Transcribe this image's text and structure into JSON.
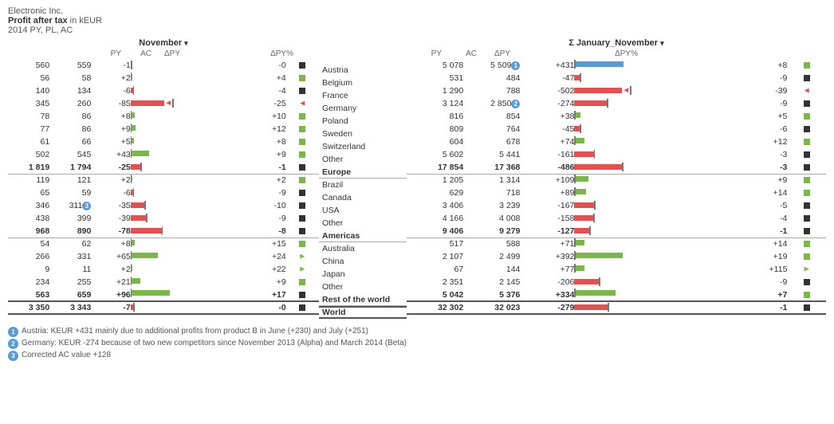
{
  "header": {
    "company": "Electronic Inc.",
    "metric": "Profit after tax",
    "unit": "in kEUR",
    "year_line": "2014 PY, PL, AC"
  },
  "left_panel": {
    "title": "November",
    "col_headers": [
      "PY",
      "AC",
      "ΔPY",
      "",
      "ΔPY%",
      ""
    ],
    "rows": [
      {
        "region": "Austria",
        "py": "560",
        "ac": "559",
        "dpy": "-1",
        "dpy_bar": {
          "type": "neg",
          "val": -1
        },
        "dpyp": "-0",
        "dpyp_bar": {
          "type": "sq",
          "color": "dark"
        }
      },
      {
        "region": "Belgium",
        "py": "56",
        "ac": "58",
        "dpy": "+2",
        "dpy_bar": {
          "type": "pos",
          "val": 2
        },
        "dpyp": "+4",
        "dpyp_bar": {
          "type": "sq",
          "color": "green"
        }
      },
      {
        "region": "France",
        "py": "140",
        "ac": "134",
        "dpy": "-6",
        "dpy_bar": {
          "type": "neg",
          "val": -6
        },
        "dpyp": "-4",
        "dpyp_bar": {
          "type": "sq",
          "color": "dark"
        }
      },
      {
        "region": "Germany",
        "py": "345",
        "ac": "260",
        "dpy": "-85",
        "dpy_bar": {
          "type": "neg_arrow",
          "val": -85
        },
        "dpyp": "-25",
        "dpyp_bar": {
          "type": "arr_l",
          "color": "red"
        }
      },
      {
        "region": "Poland",
        "py": "78",
        "ac": "86",
        "dpy": "+8",
        "dpy_bar": {
          "type": "pos",
          "val": 8
        },
        "dpyp": "+10",
        "dpyp_bar": {
          "type": "sq",
          "color": "green"
        }
      },
      {
        "region": "Sweden",
        "py": "77",
        "ac": "86",
        "dpy": "+9",
        "dpy_bar": {
          "type": "pos",
          "val": 9
        },
        "dpyp": "+12",
        "dpyp_bar": {
          "type": "sq",
          "color": "green"
        }
      },
      {
        "region": "Switzerland",
        "py": "61",
        "ac": "66",
        "dpy": "+5",
        "dpy_bar": {
          "type": "pos",
          "val": 5
        },
        "dpyp": "+8",
        "dpyp_bar": {
          "type": "sq",
          "color": "green"
        }
      },
      {
        "region": "Other",
        "py": "502",
        "ac": "545",
        "dpy": "+43",
        "dpy_bar": {
          "type": "pos",
          "val": 43
        },
        "dpyp": "+9",
        "dpyp_bar": {
          "type": "sq",
          "color": "green"
        }
      },
      {
        "region": "Europe",
        "py": "1 819",
        "ac": "1 794",
        "dpy": "-25",
        "dpy_bar": {
          "type": "neg",
          "val": -25
        },
        "dpyp": "-1",
        "dpyp_bar": {
          "type": "sq",
          "color": "dark"
        },
        "total": true
      },
      {
        "region": "Brazil",
        "py": "119",
        "ac": "121",
        "dpy": "+2",
        "dpy_bar": {
          "type": "pos",
          "val": 2
        },
        "dpyp": "+2",
        "dpyp_bar": {
          "type": "sq",
          "color": "green"
        }
      },
      {
        "region": "Canada",
        "py": "65",
        "ac": "59",
        "dpy": "-6",
        "dpy_bar": {
          "type": "neg",
          "val": -6
        },
        "dpyp": "-9",
        "dpyp_bar": {
          "type": "sq",
          "color": "dark"
        }
      },
      {
        "region": "USA",
        "py": "346",
        "ac": "311",
        "dpy": "-35",
        "dpy_bar": {
          "type": "neg",
          "val": -35
        },
        "dpyp": "-10",
        "dpyp_bar": {
          "type": "sq",
          "color": "dark"
        },
        "badge": "3"
      },
      {
        "region": "Other",
        "py": "438",
        "ac": "399",
        "dpy": "-39",
        "dpy_bar": {
          "type": "neg",
          "val": -39
        },
        "dpyp": "-9",
        "dpyp_bar": {
          "type": "sq",
          "color": "dark"
        }
      },
      {
        "region": "Americas",
        "py": "968",
        "ac": "890",
        "dpy": "-78",
        "dpy_bar": {
          "type": "neg",
          "val": -78
        },
        "dpyp": "-8",
        "dpyp_bar": {
          "type": "sq",
          "color": "dark"
        },
        "total": true
      },
      {
        "region": "Australia",
        "py": "54",
        "ac": "62",
        "dpy": "+8",
        "dpy_bar": {
          "type": "pos",
          "val": 8
        },
        "dpyp": "+15",
        "dpyp_bar": {
          "type": "sq",
          "color": "green"
        }
      },
      {
        "region": "China",
        "py": "266",
        "ac": "331",
        "dpy": "+65",
        "dpy_bar": {
          "type": "pos",
          "val": 65
        },
        "dpyp": "+24",
        "dpyp_bar": {
          "type": "arr_r",
          "color": "green"
        }
      },
      {
        "region": "Japan",
        "py": "9",
        "ac": "11",
        "dpy": "+2",
        "dpy_bar": {
          "type": "pos",
          "val": 2
        },
        "dpyp": "+22",
        "dpyp_bar": {
          "type": "arr_r",
          "color": "green"
        }
      },
      {
        "region": "Other",
        "py": "234",
        "ac": "255",
        "dpy": "+21",
        "dpy_bar": {
          "type": "pos",
          "val": 21
        },
        "dpyp": "+9",
        "dpyp_bar": {
          "type": "sq",
          "color": "green"
        }
      },
      {
        "region": "Rest of the world",
        "py": "563",
        "ac": "659",
        "dpy": "+96",
        "dpy_bar": {
          "type": "pos",
          "val": 96
        },
        "dpyp": "+17",
        "dpyp_bar": {
          "type": "sq",
          "color": "dark"
        },
        "total": true
      },
      {
        "region": "World",
        "py": "3 350",
        "ac": "3 343",
        "dpy": "-7",
        "dpy_bar": {
          "type": "neg",
          "val": -7
        },
        "dpyp": "-0",
        "dpyp_bar": {
          "type": "sq",
          "color": "dark"
        },
        "grand": true
      }
    ]
  },
  "right_panel": {
    "title": "Σ January_November",
    "col_headers": [
      "PY",
      "AC",
      "ΔPY",
      "",
      "ΔPY%",
      ""
    ],
    "rows": [
      {
        "py": "5 078",
        "ac": "5 509",
        "dpy": "+431",
        "dpy_bar": {
          "type": "pos_blue",
          "val": 431
        },
        "dpyp": "+8",
        "dpyp_bar": {
          "type": "sq",
          "color": "green"
        },
        "badge": "1"
      },
      {
        "py": "531",
        "ac": "484",
        "dpy": "-47",
        "dpy_bar": {
          "type": "neg",
          "val": -47
        },
        "dpyp": "-9",
        "dpyp_bar": {
          "type": "sq",
          "color": "dark"
        }
      },
      {
        "py": "1 290",
        "ac": "788",
        "dpy": "-502",
        "dpy_bar": {
          "type": "neg_arrow",
          "val": -502
        },
        "dpyp": "-39",
        "dpyp_bar": {
          "type": "arr_l",
          "color": "red"
        }
      },
      {
        "py": "3 124",
        "ac": "2 850",
        "dpy": "-274",
        "dpy_bar": {
          "type": "neg",
          "val": -274
        },
        "dpyp": "-9",
        "dpyp_bar": {
          "type": "sq",
          "color": "dark"
        },
        "badge": "2"
      },
      {
        "py": "816",
        "ac": "854",
        "dpy": "+38",
        "dpy_bar": {
          "type": "pos",
          "val": 38
        },
        "dpyp": "+5",
        "dpyp_bar": {
          "type": "sq",
          "color": "green"
        }
      },
      {
        "py": "809",
        "ac": "764",
        "dpy": "-45",
        "dpy_bar": {
          "type": "neg",
          "val": -45
        },
        "dpyp": "-6",
        "dpyp_bar": {
          "type": "sq",
          "color": "dark"
        }
      },
      {
        "py": "604",
        "ac": "678",
        "dpy": "+74",
        "dpy_bar": {
          "type": "pos",
          "val": 74
        },
        "dpyp": "+12",
        "dpyp_bar": {
          "type": "sq",
          "color": "green"
        }
      },
      {
        "py": "5 602",
        "ac": "5 441",
        "dpy": "-161",
        "dpy_bar": {
          "type": "neg",
          "val": -161
        },
        "dpyp": "-3",
        "dpyp_bar": {
          "type": "sq",
          "color": "dark"
        }
      },
      {
        "py": "17 854",
        "ac": "17 368",
        "dpy": "-486",
        "dpy_bar": {
          "type": "neg",
          "val": -486
        },
        "dpyp": "-3",
        "dpyp_bar": {
          "type": "sq",
          "color": "dark"
        },
        "total": true
      },
      {
        "py": "1 205",
        "ac": "1 314",
        "dpy": "+109",
        "dpy_bar": {
          "type": "pos",
          "val": 109
        },
        "dpyp": "+9",
        "dpyp_bar": {
          "type": "sq",
          "color": "green"
        }
      },
      {
        "py": "629",
        "ac": "718",
        "dpy": "+89",
        "dpy_bar": {
          "type": "pos",
          "val": 89
        },
        "dpyp": "+14",
        "dpyp_bar": {
          "type": "sq",
          "color": "green"
        }
      },
      {
        "py": "3 406",
        "ac": "3 239",
        "dpy": "-167",
        "dpy_bar": {
          "type": "neg",
          "val": -167
        },
        "dpyp": "-5",
        "dpyp_bar": {
          "type": "sq",
          "color": "dark"
        }
      },
      {
        "py": "4 166",
        "ac": "4 008",
        "dpy": "-158",
        "dpy_bar": {
          "type": "neg",
          "val": -158
        },
        "dpyp": "-4",
        "dpyp_bar": {
          "type": "sq",
          "color": "dark"
        }
      },
      {
        "py": "9 406",
        "ac": "9 279",
        "dpy": "-127",
        "dpy_bar": {
          "type": "neg",
          "val": -127
        },
        "dpyp": "-1",
        "dpyp_bar": {
          "type": "sq",
          "color": "dark"
        },
        "total": true
      },
      {
        "py": "517",
        "ac": "588",
        "dpy": "+71",
        "dpy_bar": {
          "type": "pos",
          "val": 71
        },
        "dpyp": "+14",
        "dpyp_bar": {
          "type": "sq",
          "color": "green"
        }
      },
      {
        "py": "2 107",
        "ac": "2 499",
        "dpy": "+392",
        "dpy_bar": {
          "type": "pos",
          "val": 392
        },
        "dpyp": "+19",
        "dpyp_bar": {
          "type": "sq",
          "color": "green"
        }
      },
      {
        "py": "67",
        "ac": "144",
        "dpy": "+77",
        "dpy_bar": {
          "type": "pos",
          "val": 77
        },
        "dpyp": "+115",
        "dpyp_bar": {
          "type": "arr_r",
          "color": "green"
        }
      },
      {
        "py": "2 351",
        "ac": "2 145",
        "dpy": "-206",
        "dpy_bar": {
          "type": "neg",
          "val": -206
        },
        "dpyp": "-9",
        "dpyp_bar": {
          "type": "sq",
          "color": "dark"
        }
      },
      {
        "py": "5 042",
        "ac": "5 376",
        "dpy": "+334",
        "dpy_bar": {
          "type": "pos",
          "val": 334
        },
        "dpyp": "+7",
        "dpyp_bar": {
          "type": "sq",
          "color": "green"
        },
        "total": true
      },
      {
        "py": "32 302",
        "ac": "32 023",
        "dpy": "-279",
        "dpy_bar": {
          "type": "neg",
          "val": -279
        },
        "dpyp": "-1",
        "dpyp_bar": {
          "type": "sq",
          "color": "dark"
        },
        "grand": true
      }
    ]
  },
  "footnotes": [
    {
      "id": "1",
      "color": "#5b9bd5",
      "text": "Austria: KEUR +431 mainly due to additional profits from product B in June (+230) and July (+251)"
    },
    {
      "id": "2",
      "color": "#5b9bd5",
      "text": "Germany: KEUR -274 because of two new competitors since November 2013 (Alpha) and March 2014 (Beta)"
    },
    {
      "id": "3",
      "color": "#5b9bd5",
      "text": "Corrected AC value +128"
    }
  ]
}
